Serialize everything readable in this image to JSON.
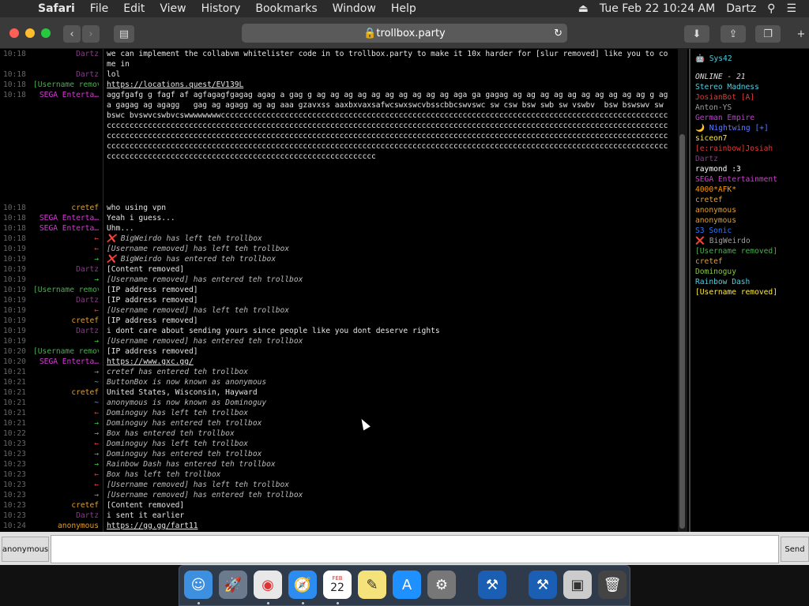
{
  "menubar": {
    "app": "Safari",
    "items": [
      "File",
      "Edit",
      "View",
      "History",
      "Bookmarks",
      "Window",
      "Help"
    ],
    "datetime": "Tue Feb 22  10:24 AM",
    "user": "Dartz"
  },
  "toolbar": {
    "url": "trollbox.party"
  },
  "chat": [
    {
      "t": "10:18",
      "n": "Dartz",
      "nc": "#8a3b8a",
      "m": "we can implement the collabvm whitelister code in to trollbox.party to make it 10x harder for [slur removed] like you to come in",
      "h": 2
    },
    {
      "t": "10:18",
      "n": "Dartz",
      "nc": "#8a3b8a",
      "m": "lol",
      "h": 1
    },
    {
      "t": "10:18",
      "n": "[Username removed]",
      "nc": "#4caf50",
      "m": "https://locations.quest/EV139L",
      "link": true,
      "h": 1
    },
    {
      "t": "10:18",
      "n": "SEGA Enterta…",
      "nc": "#d43bd4",
      "m": "aggfgafg g fagf af agfagagfgagag agag a gag g ag ag ag ag ag ag ag ag ag ag aga ga gagag ag ag ag ag ag ag ag ag ag ag g ag a gagag ag agagg   gag ag agagg ag ag aaa gzavxss aaxbxvaxsafwcswxswcvbsscbbcswvswc sw csw bsw swb sw vswbv  bsw bswswv sw bswc bvswvcswbvcswwwwwwwwcccccccccccccccccccccccccccccccccccccccccccccccccccccccccccccccccccccccccccccccccccccccccccccccccccccccccccccccccccccccccccccccccccccccccccccccccccccccccccccccccccccccccccccccccccccccccccccccccccccccccccccccccccccccccccccccccccccccccccccccccccccccccccccccccccccccccccccccccccccccccccccccccccccccccccccccccccccccccccccccccccccccccccccccccccccccccccccccccccccccccccccccccccccccccccccccccccccccccccccccccccccccccccccccccccccccccccccccccccccccccccccccccccccccccccccccccccccccccccccccccccccccccccccccccccccccccccccccccccccccccccccc",
      "h": 11
    },
    {
      "t": "10:18",
      "n": "cretef",
      "nc": "#e0a030",
      "m": "who using vpn",
      "h": 1
    },
    {
      "t": "10:18",
      "n": "SEGA Enterta…",
      "nc": "#d43bd4",
      "m": "Yeah i guess...",
      "h": 1
    },
    {
      "t": "10:18",
      "n": "SEGA Enterta…",
      "nc": "#d43bd4",
      "m": "Uhm...",
      "h": 1
    },
    {
      "t": "10:18",
      "n": "←",
      "nc": "#e04040",
      "m": "❌ BigWeirdo has left teh trollbox",
      "ev": true,
      "h": 1
    },
    {
      "t": "10:19",
      "n": "←",
      "nc": "#e04040",
      "m": "[Username removed] has left teh trollbox",
      "ev": true,
      "h": 1
    },
    {
      "t": "10:19",
      "n": "→",
      "nc": "#40d040",
      "m": "❌ BigWeirdo has entered teh trollbox",
      "ev": true,
      "h": 1
    },
    {
      "t": "10:19",
      "n": "Dartz",
      "nc": "#8a3b8a",
      "m": "[Content removed]",
      "h": 1
    },
    {
      "t": "10:19",
      "n": "→",
      "nc": "#40d040",
      "m": "[Username removed] has entered teh trollbox",
      "ev": true,
      "h": 1
    },
    {
      "t": "10:19",
      "n": "[Username removed]",
      "nc": "#4caf50",
      "m": "[IP address removed]",
      "h": 1
    },
    {
      "t": "10:19",
      "n": "Dartz",
      "nc": "#8a3b8a",
      "m": "[IP address removed]",
      "h": 1
    },
    {
      "t": "10:19",
      "n": "←",
      "nc": "#e04040",
      "m": "[Username removed] has left teh trollbox",
      "ev": true,
      "h": 1
    },
    {
      "t": "10:19",
      "n": "cretef",
      "nc": "#e0a030",
      "m": "[IP address removed]",
      "h": 1
    },
    {
      "t": "10:19",
      "n": "Dartz",
      "nc": "#8a3b8a",
      "m": "i dont care about sending yours since people like you dont deserve rights",
      "h": 1
    },
    {
      "t": "10:19",
      "n": "→",
      "nc": "#40d040",
      "m": "[Username removed] has entered teh trollbox",
      "ev": true,
      "h": 1
    },
    {
      "t": "10:20",
      "n": "[Username removed]",
      "nc": "#4caf50",
      "m": "[IP address removed]",
      "h": 1
    },
    {
      "t": "10:20",
      "n": "SEGA Enterta…",
      "nc": "#d43bd4",
      "m": "https://www.gxc.gg/",
      "link": true,
      "h": 1
    },
    {
      "t": "10:21",
      "n": "→",
      "nc": "#40d040",
      "m": "cretef has entered teh trollbox",
      "ev": true,
      "h": 1
    },
    {
      "t": "10:21",
      "n": "~",
      "nc": "#4da3ff",
      "m": "ButtonBox is now known as anonymous",
      "ev": true,
      "h": 1
    },
    {
      "t": "10:21",
      "n": "cretef",
      "nc": "#e0a030",
      "m": "United States, Wisconsin, Hayward",
      "h": 1
    },
    {
      "t": "10:21",
      "n": "~",
      "nc": "#4da3ff",
      "m": "anonymous is now known as Dominoguy",
      "ev": true,
      "h": 1
    },
    {
      "t": "10:21",
      "n": "←",
      "nc": "#e04040",
      "m": "Dominoguy has left teh trollbox",
      "ev": true,
      "h": 1
    },
    {
      "t": "10:21",
      "n": "→",
      "nc": "#40d040",
      "m": "Dominoguy has entered teh trollbox",
      "ev": true,
      "h": 1
    },
    {
      "t": "10:22",
      "n": "→",
      "nc": "#40d040",
      "m": "Box has entered teh trollbox",
      "ev": true,
      "h": 1
    },
    {
      "t": "10:23",
      "n": "←",
      "nc": "#e04040",
      "m": "Dominoguy has left teh trollbox",
      "ev": true,
      "h": 1
    },
    {
      "t": "10:23",
      "n": "→",
      "nc": "#40d040",
      "m": "Dominoguy has entered teh trollbox",
      "ev": true,
      "h": 1
    },
    {
      "t": "10:23",
      "n": "→",
      "nc": "#40d040",
      "m": "Rainbow Dash has entered teh trollbox",
      "ev": true,
      "h": 1
    },
    {
      "t": "10:23",
      "n": "←",
      "nc": "#e04040",
      "m": "Box has left teh trollbox",
      "ev": true,
      "h": 1
    },
    {
      "t": "10:23",
      "n": "←",
      "nc": "#e04040",
      "m": "[Username removed] has left teh trollbox",
      "ev": true,
      "h": 1
    },
    {
      "t": "10:23",
      "n": "→",
      "nc": "#40d040",
      "m": "[Username removed] has entered teh trollbox",
      "ev": true,
      "h": 1
    },
    {
      "t": "10:23",
      "n": "cretef",
      "nc": "#e0a030",
      "m": "[Content removed]",
      "h": 1
    },
    {
      "t": "10:23",
      "n": "Dartz",
      "nc": "#8a3b8a",
      "m": "i sent it earlier",
      "h": 1
    },
    {
      "t": "10:24",
      "n": "anonymous",
      "nc": "#e0a030",
      "m": "https://gg.gg/fart11",
      "link": true,
      "h": 1
    }
  ],
  "sidebar": {
    "top": "Sys42",
    "online_label": "ONLINE - 21",
    "users": [
      {
        "n": "Stereo Madness",
        "c": "#4dd0e1"
      },
      {
        "n": "JosianBot [A]",
        "c": "#e53935"
      },
      {
        "n": "Anton-YS",
        "c": "#9e9e9e"
      },
      {
        "n": "German Empire",
        "c": "#c040d0"
      },
      {
        "n": "🌙 Nightwing [+]",
        "c": "#5c7cff"
      },
      {
        "n": "siceon7",
        "c": "#ffeb3b"
      },
      {
        "n": "[e:rainbow]Josiah",
        "c": "#e53935"
      },
      {
        "n": "Dartz",
        "c": "#8a3b8a"
      },
      {
        "n": "raymond :3",
        "c": "#ffffff"
      },
      {
        "n": "SEGA Entertainment",
        "c": "#d43bd4"
      },
      {
        "n": "4000*AFK*",
        "c": "#ff9800"
      },
      {
        "n": "cretef",
        "c": "#e0a030"
      },
      {
        "n": "anonymous",
        "c": "#e0a030"
      },
      {
        "n": "anonymous",
        "c": "#e0a030"
      },
      {
        "n": "S3 Sonic",
        "c": "#2979ff"
      },
      {
        "n": "❌ BigWeirdo",
        "c": "#9e9e9e"
      },
      {
        "n": "[Username removed]",
        "c": "#4caf50"
      },
      {
        "n": "cretef",
        "c": "#e0a030"
      },
      {
        "n": "Dominoguy",
        "c": "#8bc34a"
      },
      {
        "n": "Rainbow Dash",
        "c": "#4dd0e1"
      },
      {
        "n": "[Username removed]",
        "c": "#ffeb3b"
      }
    ]
  },
  "bottom": {
    "nick": "anonymous",
    "send": "Send",
    "placeholder": ""
  },
  "dock": [
    "Finder",
    "Launchpad",
    "Chrome",
    "Safari",
    "Calendar",
    "Notes",
    "App Store",
    "System Preferences",
    "Xcode",
    "Xcode",
    "Preview",
    "Trash"
  ],
  "dock_calendar": {
    "month": "FEB",
    "day": "22"
  }
}
